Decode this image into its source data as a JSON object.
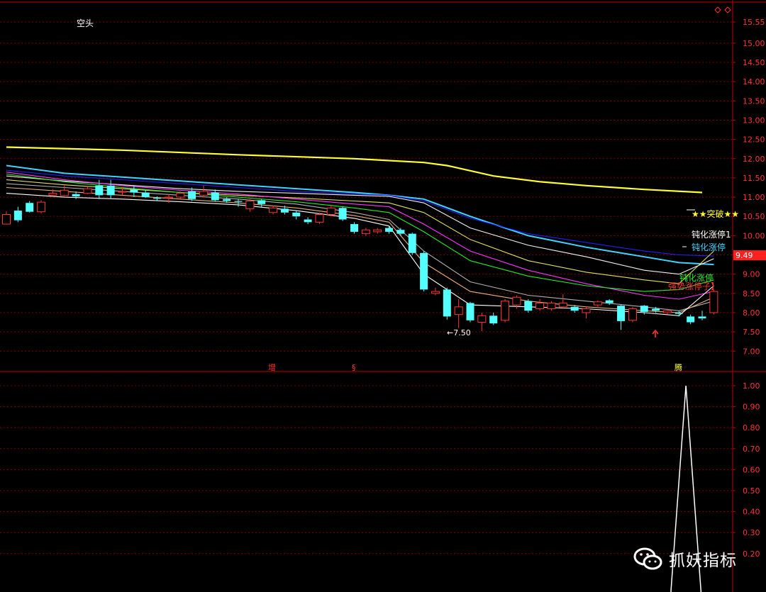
{
  "top_label": "空头",
  "top_right_icons": [
    "diamond-icon",
    "diamond-icon"
  ],
  "watermark": {
    "icon": "wechat-icon",
    "text": "抓妖指标"
  },
  "colors": {
    "up": "#ff3333",
    "down": "#54ffff",
    "grid": "#7a0000",
    "axis": "#c00000",
    "ma": [
      "#ffff33",
      "#3fd3ff",
      "#2020ff",
      "#f2f2f2",
      "#e0e060",
      "#ff33ff",
      "#22ee22",
      "#b0b0b0",
      "#e8b07a",
      "#ffffff"
    ],
    "ind": "#ffffff",
    "price_tag_bg": "#ff2020"
  },
  "chart_data": [
    {
      "type": "candlestick",
      "title": "",
      "y_ticks": [
        "15.55",
        "15.00",
        "14.50",
        "14.00",
        "13.50",
        "13.00",
        "12.50",
        "12.00",
        "11.50",
        "11.00",
        "10.50",
        "10.00",
        "9.50",
        "9.00",
        "8.50",
        "8.00",
        "7.50",
        "7.00"
      ],
      "ylim": [
        6.55,
        15.8
      ],
      "current_price": "9.49",
      "low_marker": "←7.50",
      "bottom_markers": [
        "增",
        "§",
        "腾"
      ],
      "annotations": {
        "breakout": "★★突破★★",
        "strong1": "钝化涨停1",
        "strong2": "钝化涨停",
        "strong3": "钝化涨停",
        "strong4": "强势涨停子】"
      },
      "candles": [
        [
          10.3,
          10.55,
          10.63,
          10.42
        ],
        [
          10.65,
          10.4,
          10.75,
          10.35
        ],
        [
          10.85,
          10.62,
          10.9,
          10.6
        ],
        [
          10.62,
          10.87,
          10.92,
          10.58
        ],
        [
          11.05,
          11.1,
          11.2,
          11.02
        ],
        [
          11.04,
          11.18,
          11.3,
          11.0
        ],
        [
          11.08,
          11.02,
          11.15,
          10.95
        ],
        [
          11.1,
          11.22,
          11.3,
          11.08
        ],
        [
          11.3,
          11.05,
          11.45,
          10.95
        ],
        [
          11.3,
          11.05,
          11.45,
          10.95
        ],
        [
          11.15,
          11.15,
          11.25,
          11.05
        ],
        [
          11.2,
          11.12,
          11.3,
          11.0
        ],
        [
          11.12,
          11.0,
          11.18,
          10.98
        ],
        [
          10.98,
          10.97,
          11.02,
          10.9
        ],
        [
          10.98,
          11.0,
          11.08,
          10.85
        ],
        [
          11.0,
          11.1,
          11.15,
          10.95
        ],
        [
          11.15,
          10.95,
          11.25,
          10.9
        ],
        [
          11.05,
          11.15,
          11.3,
          11.0
        ],
        [
          11.12,
          10.92,
          11.2,
          10.88
        ],
        [
          10.95,
          10.9,
          11.0,
          10.85
        ],
        [
          10.9,
          10.88,
          10.95,
          10.75
        ],
        [
          10.7,
          10.9,
          10.95,
          10.62
        ],
        [
          10.92,
          10.82,
          10.95,
          10.75
        ],
        [
          10.6,
          10.72,
          10.78,
          10.55
        ],
        [
          10.7,
          10.6,
          10.78,
          10.55
        ],
        [
          10.6,
          10.5,
          10.65,
          10.42
        ],
        [
          10.42,
          10.35,
          10.48,
          10.3
        ],
        [
          10.35,
          10.55,
          10.6,
          10.3
        ],
        [
          10.55,
          10.72,
          10.78,
          10.5
        ],
        [
          10.72,
          10.42,
          10.75,
          10.38
        ],
        [
          10.3,
          10.1,
          10.35,
          10.05
        ],
        [
          10.05,
          10.15,
          10.2,
          10.0
        ],
        [
          10.1,
          10.15,
          10.2,
          10.05
        ],
        [
          10.2,
          10.1,
          10.25,
          10.05
        ],
        [
          10.15,
          10.05,
          10.2,
          10.0
        ],
        [
          10.05,
          9.55,
          10.08,
          9.5
        ],
        [
          9.55,
          8.6,
          9.6,
          8.55
        ],
        [
          8.5,
          8.55,
          8.65,
          8.45
        ],
        [
          8.6,
          7.9,
          8.65,
          7.82
        ],
        [
          7.95,
          8.15,
          8.35,
          7.6
        ],
        [
          8.25,
          7.8,
          8.28,
          7.75
        ],
        [
          7.75,
          7.92,
          8.0,
          7.52
        ],
        [
          7.92,
          7.72,
          8.0,
          7.68
        ],
        [
          7.8,
          8.3,
          8.35,
          7.75
        ],
        [
          8.2,
          8.4,
          8.45,
          8.1
        ],
        [
          8.3,
          8.05,
          8.35,
          8.0
        ],
        [
          8.1,
          8.25,
          8.35,
          8.05
        ],
        [
          8.1,
          8.25,
          8.3,
          8.05
        ],
        [
          8.15,
          8.25,
          8.48,
          8.1
        ],
        [
          8.15,
          8.05,
          8.2,
          8.0
        ],
        [
          8.0,
          8.1,
          8.15,
          7.85
        ],
        [
          8.2,
          8.28,
          8.32,
          8.15
        ],
        [
          8.32,
          8.25,
          8.35,
          8.2
        ],
        [
          8.18,
          7.78,
          8.2,
          7.55
        ],
        [
          7.8,
          8.1,
          8.15,
          7.75
        ],
        [
          8.18,
          8.02,
          8.2,
          7.95
        ],
        [
          8.1,
          8.05,
          8.15,
          8.0
        ],
        [
          8.0,
          8.05,
          8.1,
          7.95
        ],
        [
          8.0,
          7.97,
          8.05,
          7.9
        ],
        [
          7.9,
          7.75,
          7.95,
          7.7
        ],
        [
          7.9,
          7.85,
          8.05,
          7.8
        ],
        [
          8.0,
          8.55,
          8.6,
          7.95
        ]
      ],
      "moving_averages": [
        {
          "color_index": 0,
          "points": [
            [
              0,
              12.3
            ],
            [
              10,
              12.22
            ],
            [
              20,
              12.1
            ],
            [
              30,
              12.0
            ],
            [
              36,
              11.9
            ],
            [
              38,
              11.82
            ],
            [
              42,
              11.55
            ],
            [
              46,
              11.4
            ],
            [
              50,
              11.3
            ],
            [
              55,
              11.2
            ],
            [
              60,
              11.12
            ]
          ]
        },
        {
          "color_index": 1,
          "points": [
            [
              0,
              11.82
            ],
            [
              5,
              11.62
            ],
            [
              10,
              11.52
            ],
            [
              15,
              11.42
            ],
            [
              20,
              11.32
            ],
            [
              25,
              11.22
            ],
            [
              30,
              11.12
            ],
            [
              33,
              11.05
            ],
            [
              36,
              10.95
            ],
            [
              40,
              10.5
            ],
            [
              45,
              10.0
            ],
            [
              50,
              9.7
            ],
            [
              55,
              9.45
            ],
            [
              58,
              9.3
            ],
            [
              61,
              9.25
            ]
          ]
        },
        {
          "color_index": 2,
          "points": [
            [
              0,
              11.7
            ],
            [
              5,
              11.55
            ],
            [
              10,
              11.45
            ],
            [
              15,
              11.35
            ],
            [
              20,
              11.25
            ],
            [
              25,
              11.15
            ],
            [
              30,
              11.08
            ],
            [
              33,
              11.05
            ],
            [
              36,
              10.9
            ],
            [
              40,
              10.45
            ],
            [
              45,
              10.05
            ],
            [
              50,
              9.82
            ],
            [
              55,
              9.6
            ],
            [
              58,
              9.5
            ],
            [
              61,
              9.47
            ]
          ]
        },
        {
          "color_index": 3,
          "points": [
            [
              0,
              11.55
            ],
            [
              5,
              11.42
            ],
            [
              10,
              11.32
            ],
            [
              15,
              11.22
            ],
            [
              20,
              11.15
            ],
            [
              25,
              11.1
            ],
            [
              30,
              11.05
            ],
            [
              33,
              11.02
            ],
            [
              36,
              10.85
            ],
            [
              40,
              10.2
            ],
            [
              45,
              9.75
            ],
            [
              50,
              9.45
            ],
            [
              55,
              9.1
            ],
            [
              58,
              9.0
            ],
            [
              61,
              9.4
            ]
          ]
        },
        {
          "color_index": 4,
          "points": [
            [
              0,
              11.45
            ],
            [
              5,
              11.32
            ],
            [
              10,
              11.22
            ],
            [
              15,
              11.12
            ],
            [
              20,
              11.05
            ],
            [
              25,
              10.98
            ],
            [
              30,
              10.9
            ],
            [
              33,
              10.85
            ],
            [
              36,
              10.6
            ],
            [
              40,
              9.9
            ],
            [
              45,
              9.35
            ],
            [
              50,
              9.05
            ],
            [
              55,
              8.85
            ],
            [
              58,
              8.75
            ],
            [
              61,
              9.6
            ]
          ]
        },
        {
          "color_index": 5,
          "points": [
            [
              0,
              11.65
            ],
            [
              5,
              11.45
            ],
            [
              10,
              11.3
            ],
            [
              15,
              11.18
            ],
            [
              20,
              11.08
            ],
            [
              25,
              10.95
            ],
            [
              30,
              10.82
            ],
            [
              33,
              10.75
            ],
            [
              36,
              10.3
            ],
            [
              40,
              9.6
            ],
            [
              45,
              9.1
            ],
            [
              50,
              8.75
            ],
            [
              55,
              8.45
            ],
            [
              58,
              8.35
            ],
            [
              61,
              8.55
            ]
          ]
        },
        {
          "color_index": 6,
          "points": [
            [
              0,
              11.6
            ],
            [
              5,
              11.4
            ],
            [
              10,
              11.25
            ],
            [
              15,
              11.12
            ],
            [
              20,
              11.0
            ],
            [
              25,
              10.88
            ],
            [
              30,
              10.72
            ],
            [
              33,
              10.6
            ],
            [
              36,
              10.1
            ],
            [
              40,
              9.35
            ],
            [
              45,
              8.95
            ],
            [
              50,
              8.7
            ],
            [
              55,
              8.55
            ],
            [
              58,
              8.6
            ],
            [
              61,
              8.85
            ]
          ]
        },
        {
          "color_index": 7,
          "points": [
            [
              0,
              11.35
            ],
            [
              5,
              11.25
            ],
            [
              10,
              11.15
            ],
            [
              15,
              11.05
            ],
            [
              20,
              10.95
            ],
            [
              25,
              10.82
            ],
            [
              30,
              10.6
            ],
            [
              33,
              10.42
            ],
            [
              36,
              9.6
            ],
            [
              40,
              8.8
            ],
            [
              45,
              8.45
            ],
            [
              50,
              8.3
            ],
            [
              55,
              8.15
            ],
            [
              58,
              8.05
            ],
            [
              61,
              8.3
            ]
          ]
        },
        {
          "color_index": 8,
          "points": [
            [
              0,
              11.25
            ],
            [
              5,
              11.15
            ],
            [
              10,
              11.05
            ],
            [
              15,
              10.95
            ],
            [
              20,
              10.85
            ],
            [
              25,
              10.72
            ],
            [
              30,
              10.52
            ],
            [
              33,
              10.35
            ],
            [
              36,
              9.3
            ],
            [
              40,
              8.55
            ],
            [
              45,
              8.3
            ],
            [
              50,
              8.15
            ],
            [
              55,
              8.05
            ],
            [
              58,
              8.0
            ],
            [
              61,
              8.4
            ]
          ]
        },
        {
          "color_index": 9,
          "points": [
            [
              0,
              11.1
            ],
            [
              5,
              11.0
            ],
            [
              10,
              10.95
            ],
            [
              15,
              10.88
            ],
            [
              20,
              10.8
            ],
            [
              25,
              10.65
            ],
            [
              30,
              10.45
            ],
            [
              33,
              10.25
            ],
            [
              36,
              9.0
            ],
            [
              40,
              8.2
            ],
            [
              45,
              8.15
            ],
            [
              50,
              8.1
            ],
            [
              55,
              8.0
            ],
            [
              58,
              7.92
            ],
            [
              61,
              8.7
            ]
          ]
        }
      ]
    },
    {
      "type": "line",
      "title": "",
      "y_ticks": [
        "1.00",
        "0.90",
        "0.80",
        "0.70",
        "0.60",
        "0.50",
        "0.40",
        "0.30",
        "0.20"
      ],
      "ylim": [
        0,
        1.0
      ],
      "peak_index": 58.6,
      "points": [
        [
          57.3,
          0
        ],
        [
          58.6,
          1.0
        ],
        [
          59.9,
          0
        ]
      ]
    }
  ]
}
